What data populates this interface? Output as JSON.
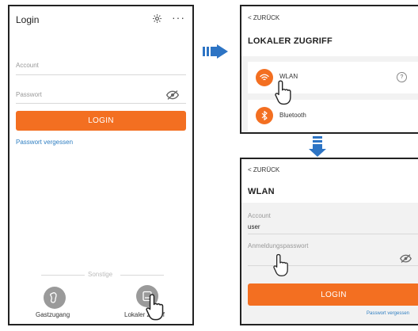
{
  "login_screen": {
    "title": "Login",
    "gear_icon": "gear-icon",
    "more_icon": "more-icon",
    "more_glyph": "···",
    "account_placeholder": "Account",
    "password_placeholder": "Passwort",
    "login_button": "LOGIN",
    "forgot_password": "Passwort vergessen",
    "other_label": "Sonstige",
    "guest_label": "Gastzugang",
    "local_access_label": "Lokaler Zugriff"
  },
  "local_access_screen": {
    "back_label": "< ZURÜCK",
    "title": "LOKALER ZUGRIFF",
    "items": [
      {
        "label": "WLAN",
        "icon": "wifi-icon"
      },
      {
        "label": "Bluetooth",
        "icon": "bluetooth-icon"
      }
    ],
    "help_icon": "help-icon",
    "help_glyph": "?"
  },
  "wlan_screen": {
    "back_label": "< ZURÜCK",
    "title": "WLAN",
    "account_label": "Account",
    "account_value": "user",
    "password_label": "Anmeldungspasswort",
    "login_button": "LOGIN",
    "forgot_password": "Passwort vergessen"
  },
  "colors": {
    "accent": "#f36f21",
    "link": "#2f7ec1",
    "arrow": "#2d74c4",
    "icon_gray": "#9a9a9a"
  }
}
